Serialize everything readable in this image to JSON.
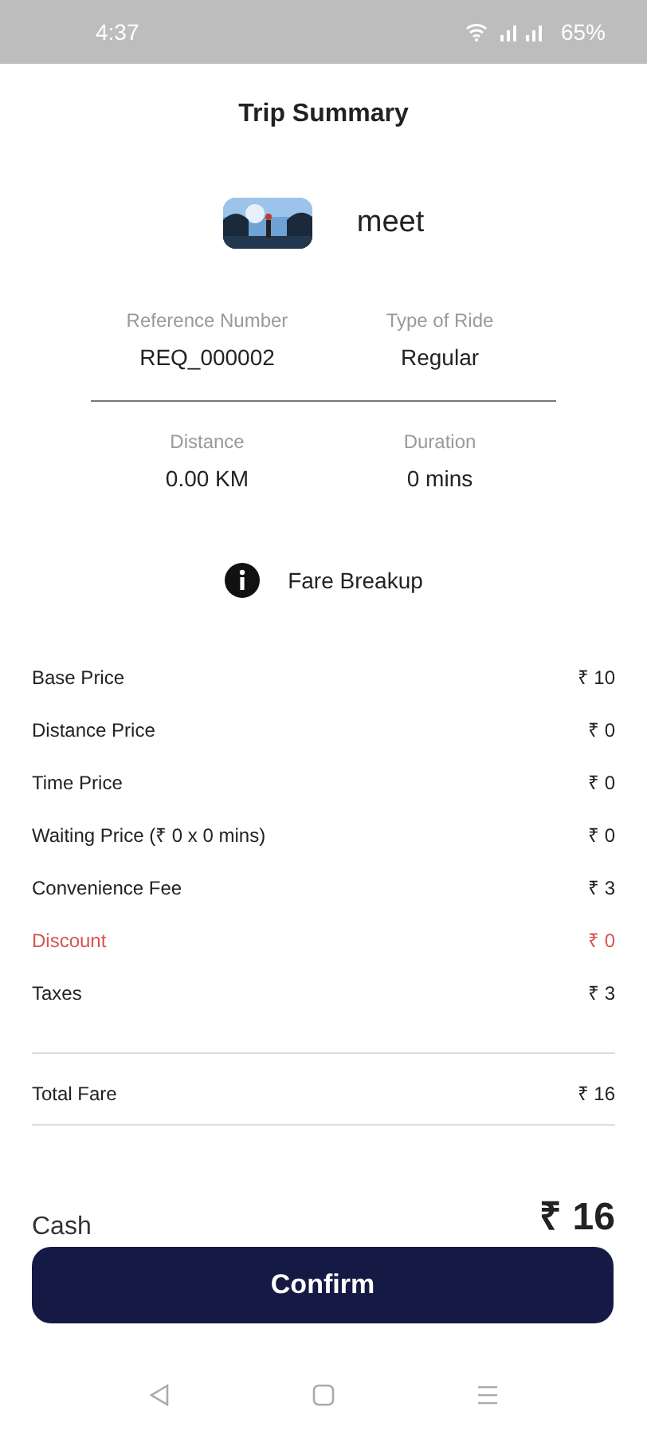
{
  "status_bar": {
    "time": "4:37",
    "battery": "65%"
  },
  "title": "Trip Summary",
  "rider": {
    "name": "meet"
  },
  "trip_info": [
    {
      "label": "Reference Number",
      "value": "REQ_000002"
    },
    {
      "label": "Type of Ride",
      "value": "Regular"
    },
    {
      "label": "Distance",
      "value": "0.00 KM"
    },
    {
      "label": "Duration",
      "value": "0 mins"
    }
  ],
  "fare_breakup": {
    "heading": "Fare Breakup",
    "items": [
      {
        "label": "Base Price",
        "amount": "₹ 10",
        "kind": "normal"
      },
      {
        "label": "Distance Price",
        "amount": "₹ 0",
        "kind": "normal"
      },
      {
        "label": "Time Price",
        "amount": "₹ 0",
        "kind": "normal"
      },
      {
        "label": "Waiting Price (₹ 0 x 0 mins)",
        "amount": "₹ 0",
        "kind": "normal"
      },
      {
        "label": "Convenience Fee",
        "amount": "₹ 3",
        "kind": "normal"
      },
      {
        "label": "Discount",
        "amount": "₹ 0",
        "kind": "discount"
      },
      {
        "label": "Taxes",
        "amount": "₹ 3",
        "kind": "normal"
      }
    ],
    "total": {
      "label": "Total Fare",
      "amount": "₹ 16"
    }
  },
  "payment": {
    "method": "Cash",
    "amount": "₹ 16"
  },
  "confirm_button": "Confirm"
}
